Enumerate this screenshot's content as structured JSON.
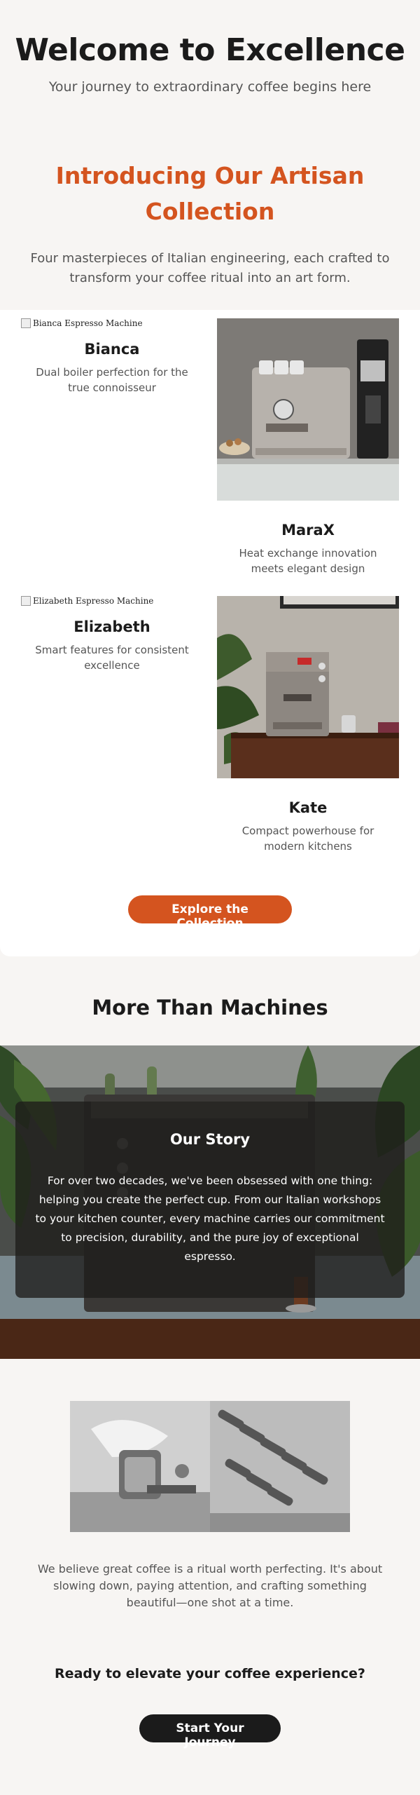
{
  "hero": {
    "title": "Welcome to Excellence",
    "subtitle": "Your journey to extraordinary coffee begins here"
  },
  "intro": {
    "title_line1": "Introducing Our Artisan",
    "title_line2": "Collection",
    "text": "Four masterpieces of Italian engineering, each crafted to transform your coffee ritual into an art form."
  },
  "colors": {
    "accent": "#d4541f",
    "dark": "#1b1b1b",
    "background": "#f7f5f3",
    "panel": "#ffffff"
  },
  "collection": [
    {
      "name": "Bianca",
      "desc": "Dual boiler perfection for the true connoisseur",
      "img_alt": "Bianca Espresso Machine"
    },
    {
      "name": "MaraX",
      "desc": "Heat exchange innovation meets elegant design"
    },
    {
      "name": "Elizabeth",
      "desc": "Smart features for consistent excellence",
      "img_alt": "Elizabeth Espresso Machine"
    },
    {
      "name": "Kate",
      "desc": "Compact powerhouse for modern kitchens"
    }
  ],
  "collection_cta": "Explore the Collection",
  "more": {
    "title": "More Than Machines",
    "story_title": "Our Story",
    "story_text": "For over two decades, we've been obsessed with one thing: helping you create the perfect cup. From our Italian workshops to your kitchen counter, every machine carries our commitment to precision, durability, and the pure joy of exceptional espresso."
  },
  "belief": "We believe great coffee is a ritual worth perfecting. It's about slowing down, paying attention, and crafting something beautiful—one shot at a time.",
  "ready": "Ready to elevate your coffee experience?",
  "final_cta": "Start Your Journey"
}
